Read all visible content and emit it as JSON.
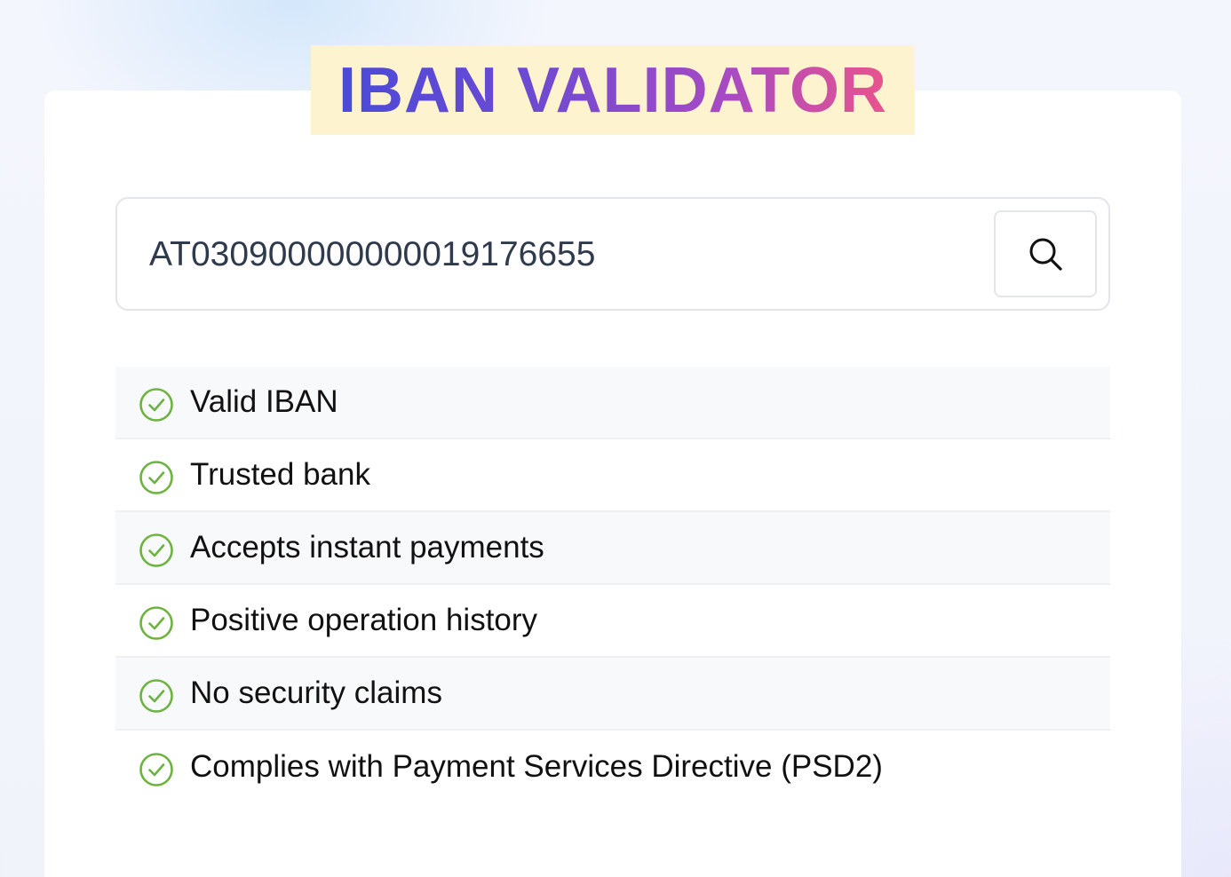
{
  "app": {
    "title": "IBAN VALIDATOR"
  },
  "search": {
    "value": "AT030900000000019176655",
    "button_icon": "search-icon"
  },
  "checks": [
    {
      "label": "Valid IBAN",
      "icon": "check-circle-icon",
      "status": "passed"
    },
    {
      "label": "Trusted bank",
      "icon": "check-circle-icon",
      "status": "passed"
    },
    {
      "label": "Accepts instant payments",
      "icon": "check-circle-icon",
      "status": "passed"
    },
    {
      "label": "Positive operation history",
      "icon": "check-circle-icon",
      "status": "passed"
    },
    {
      "label": "No security claims",
      "icon": "check-circle-icon",
      "status": "passed"
    },
    {
      "label": "Complies with Payment Services Directive (PSD2)",
      "icon": "check-circle-icon",
      "status": "passed"
    }
  ],
  "colors": {
    "title_gradient": [
      "#4a4ad8",
      "#6d4ad2",
      "#a64ac4",
      "#e9548e"
    ],
    "title_highlight": "#fdf3cf",
    "check_green": "#6db33f",
    "input_text": "#2f3b4c"
  }
}
